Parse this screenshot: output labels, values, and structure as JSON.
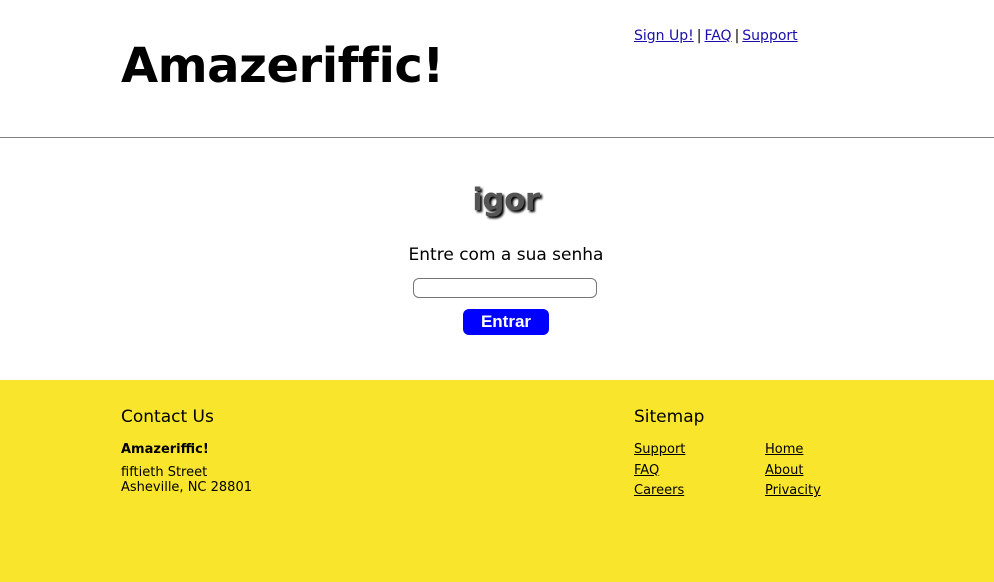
{
  "header": {
    "brand": "Amazeriffic!",
    "links": [
      {
        "label": "Sign Up!"
      },
      {
        "label": "FAQ"
      },
      {
        "label": "Support"
      }
    ],
    "separator": "|"
  },
  "main": {
    "username": "igor",
    "prompt": "Entre com a sua senha",
    "password_value": "",
    "submit_label": "Entrar"
  },
  "footer": {
    "contact": {
      "heading": "Contact Us",
      "company": "Amazeriffic!",
      "address_line1": "fiftieth Street",
      "address_line2": "Asheville, NC 28801"
    },
    "sitemap": {
      "heading": "Sitemap",
      "column1": [
        "Support",
        "FAQ",
        "Careers"
      ],
      "column2": [
        "Home",
        "About",
        "Privacity"
      ]
    }
  },
  "colors": {
    "footer_background": "#f9e52c",
    "button_background": "#0000ff",
    "link_color": "#1a0dab"
  }
}
